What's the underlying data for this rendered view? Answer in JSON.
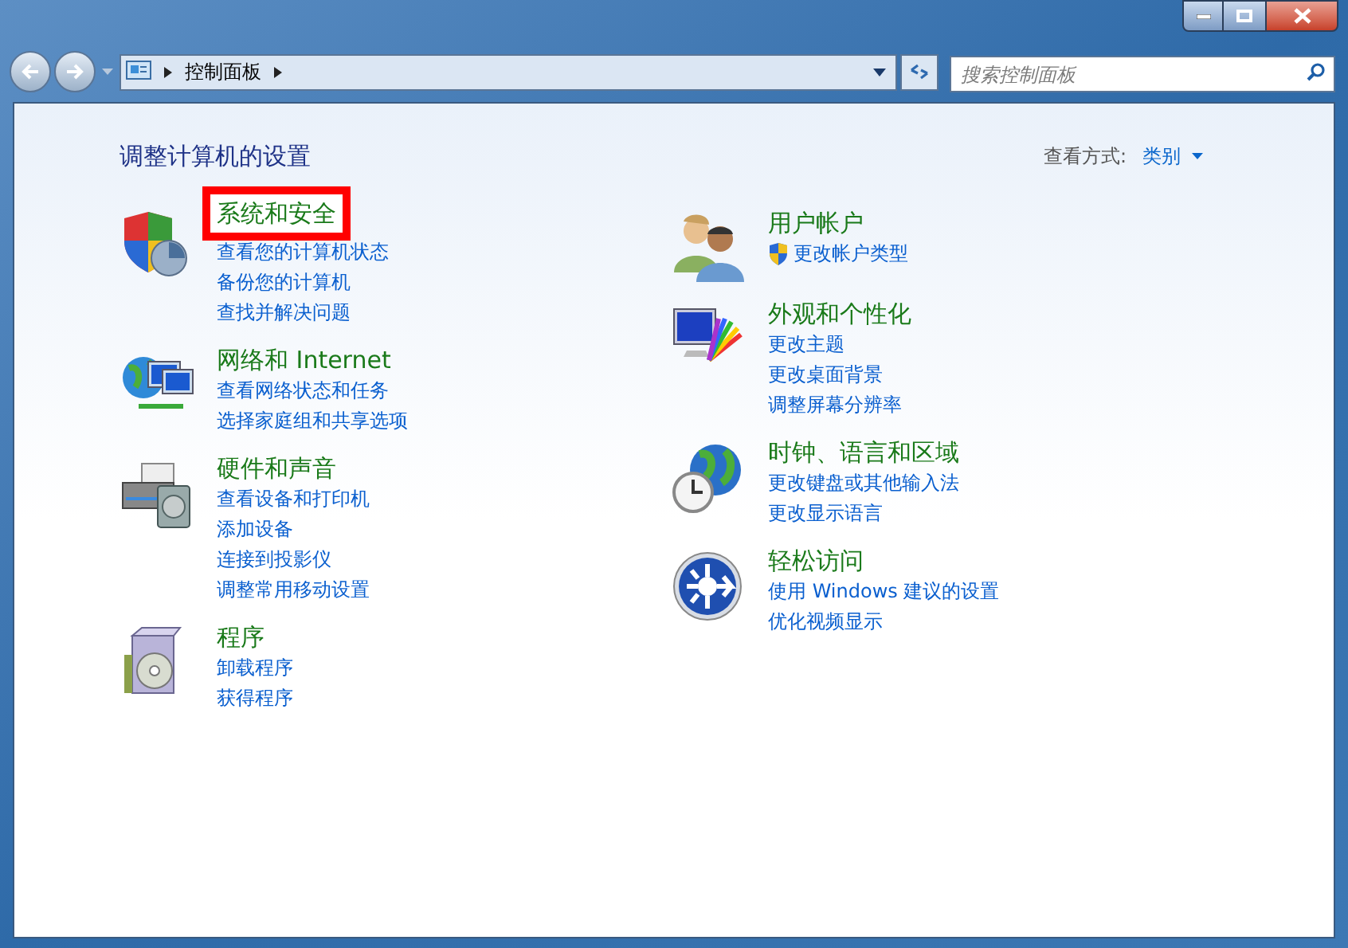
{
  "address_bar": {
    "crumbs": [
      "控制面板"
    ]
  },
  "search": {
    "placeholder": "搜索控制面板"
  },
  "heading": "调整计算机的设置",
  "view_by": {
    "label": "查看方式:",
    "value": "类别"
  },
  "columns": [
    [
      {
        "kind": "security",
        "title": "系统和安全",
        "highlighted": true,
        "links": [
          {
            "text": "查看您的计算机状态"
          },
          {
            "text": "备份您的计算机"
          },
          {
            "text": "查找并解决问题"
          }
        ]
      },
      {
        "kind": "network",
        "title": "网络和 Internet",
        "highlighted": false,
        "links": [
          {
            "text": "查看网络状态和任务"
          },
          {
            "text": "选择家庭组和共享选项"
          }
        ]
      },
      {
        "kind": "hardware",
        "title": "硬件和声音",
        "highlighted": false,
        "links": [
          {
            "text": "查看设备和打印机"
          },
          {
            "text": "添加设备"
          },
          {
            "text": "连接到投影仪"
          },
          {
            "text": "调整常用移动设置"
          }
        ]
      },
      {
        "kind": "programs",
        "title": "程序",
        "highlighted": false,
        "links": [
          {
            "text": "卸载程序"
          },
          {
            "text": "获得程序"
          }
        ]
      }
    ],
    [
      {
        "kind": "users",
        "title": "用户帐户",
        "highlighted": false,
        "links": [
          {
            "text": "更改帐户类型",
            "shield": true
          }
        ]
      },
      {
        "kind": "appearance",
        "title": "外观和个性化",
        "highlighted": false,
        "links": [
          {
            "text": "更改主题"
          },
          {
            "text": "更改桌面背景"
          },
          {
            "text": "调整屏幕分辨率"
          }
        ]
      },
      {
        "kind": "clock",
        "title": "时钟、语言和区域",
        "highlighted": false,
        "links": [
          {
            "text": "更改键盘或其他输入法"
          },
          {
            "text": "更改显示语言"
          }
        ]
      },
      {
        "kind": "access",
        "title": "轻松访问",
        "highlighted": false,
        "links": [
          {
            "text": "使用 Windows 建议的设置"
          },
          {
            "text": "优化视频显示"
          }
        ]
      }
    ]
  ]
}
